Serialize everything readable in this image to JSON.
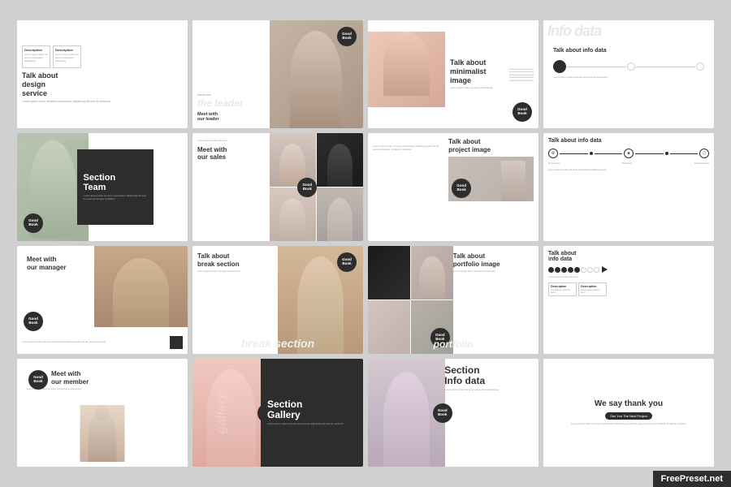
{
  "slides": [
    {
      "id": 1,
      "type": "design-service",
      "box1_title": "Description",
      "box1_text": "Lorem ipsum dolor sit amet consectetur adipiscing",
      "box2_title": "Description",
      "box2_text": "Lorem ipsum dolor sit amet consectetur adipiscing",
      "main_title": "Talk about\ndesign\nservice",
      "sub_text": "Lorem ipsum dolor sit amet consectetur adipiscing elit sed do eiusmod"
    },
    {
      "id": 2,
      "type": "the-leader",
      "name_text": "Name here",
      "italic_title": "the leader",
      "meet_text": "Meet with",
      "our_text": "our leader"
    },
    {
      "id": 3,
      "type": "minimalist-image",
      "title": "Talk about\nminimalist\nimage",
      "text": "Lorem ipsum dolor sit amet consectetur"
    },
    {
      "id": 4,
      "type": "info-data-1",
      "watermark": "Info data",
      "subtitle": "Talk about info data",
      "text": "Lorem ipsum dolor"
    },
    {
      "id": 5,
      "type": "section-team",
      "title": "Section\nTeam",
      "text": "Lorem ipsum dolor sit amet consectetur adipiscing elit sed do eiusmod tempor incididunt"
    },
    {
      "id": 6,
      "type": "sales",
      "pre_text": "Lorem ipsum dolor sit amet",
      "title": "Meet with\nour sales",
      "text": "Lorem ipsum dolor sit amet consectetur"
    },
    {
      "id": 7,
      "type": "project-image",
      "title": "Talk about\nproject image",
      "left_text": "Lorem ipsum dolor sit amet consectetur adipiscing elit sed do eiusmod tempor incididunt ut labore"
    },
    {
      "id": 8,
      "type": "info-data-2",
      "title": "Talk about info data",
      "label1": "Document",
      "label2": "Discovery",
      "label3": "Development"
    },
    {
      "id": 9,
      "type": "manager",
      "title": "Meet with\nour manager",
      "text": "Lorem ipsum dolor sit amet consectetur adipiscing elit sed do eiusmod tempor"
    },
    {
      "id": 10,
      "type": "break-section",
      "title": "Talk about\nbreak section",
      "text": "Lorem ipsum dolor sit amet consectetur",
      "watermark": "break section"
    },
    {
      "id": 11,
      "type": "portfolio-image",
      "title": "Talk about\nportfolio image",
      "text": "Lorem ipsum dolor sit amet consectetur",
      "watermark": "portfolio"
    },
    {
      "id": 12,
      "type": "info-data-3",
      "title": "Talk about\ninfo data",
      "text": "Lorem ipsum dolor sit amet",
      "box1_title": "Description",
      "box2_title": "Description"
    },
    {
      "id": 13,
      "type": "member",
      "title": "Meet with\nour member",
      "text": "Lorem ipsum dolor sit amet consectetur adipiscing"
    },
    {
      "id": 14,
      "type": "section-gallery",
      "title": "Section\nGallery",
      "text": "Lorem ipsum dolor sit amet consectetur adipiscing elit sed do eiusmod",
      "watermark": "gallery"
    },
    {
      "id": 15,
      "type": "section-info",
      "title": "Section\nInfo data",
      "text": "Lorem ipsum dolor sit amet consectetur adipiscing"
    },
    {
      "id": 16,
      "type": "thank-you",
      "title": "We say thank you",
      "badge": "See You The Next Project",
      "text": "Lorem ipsum dolor sit amet consectetur adipiscing elit sed do eiusmod tempor incididunt ut labore et dolore"
    }
  ],
  "logo": {
    "line1": "Good",
    "line2": "Book"
  },
  "watermark": "FreePreset.net"
}
